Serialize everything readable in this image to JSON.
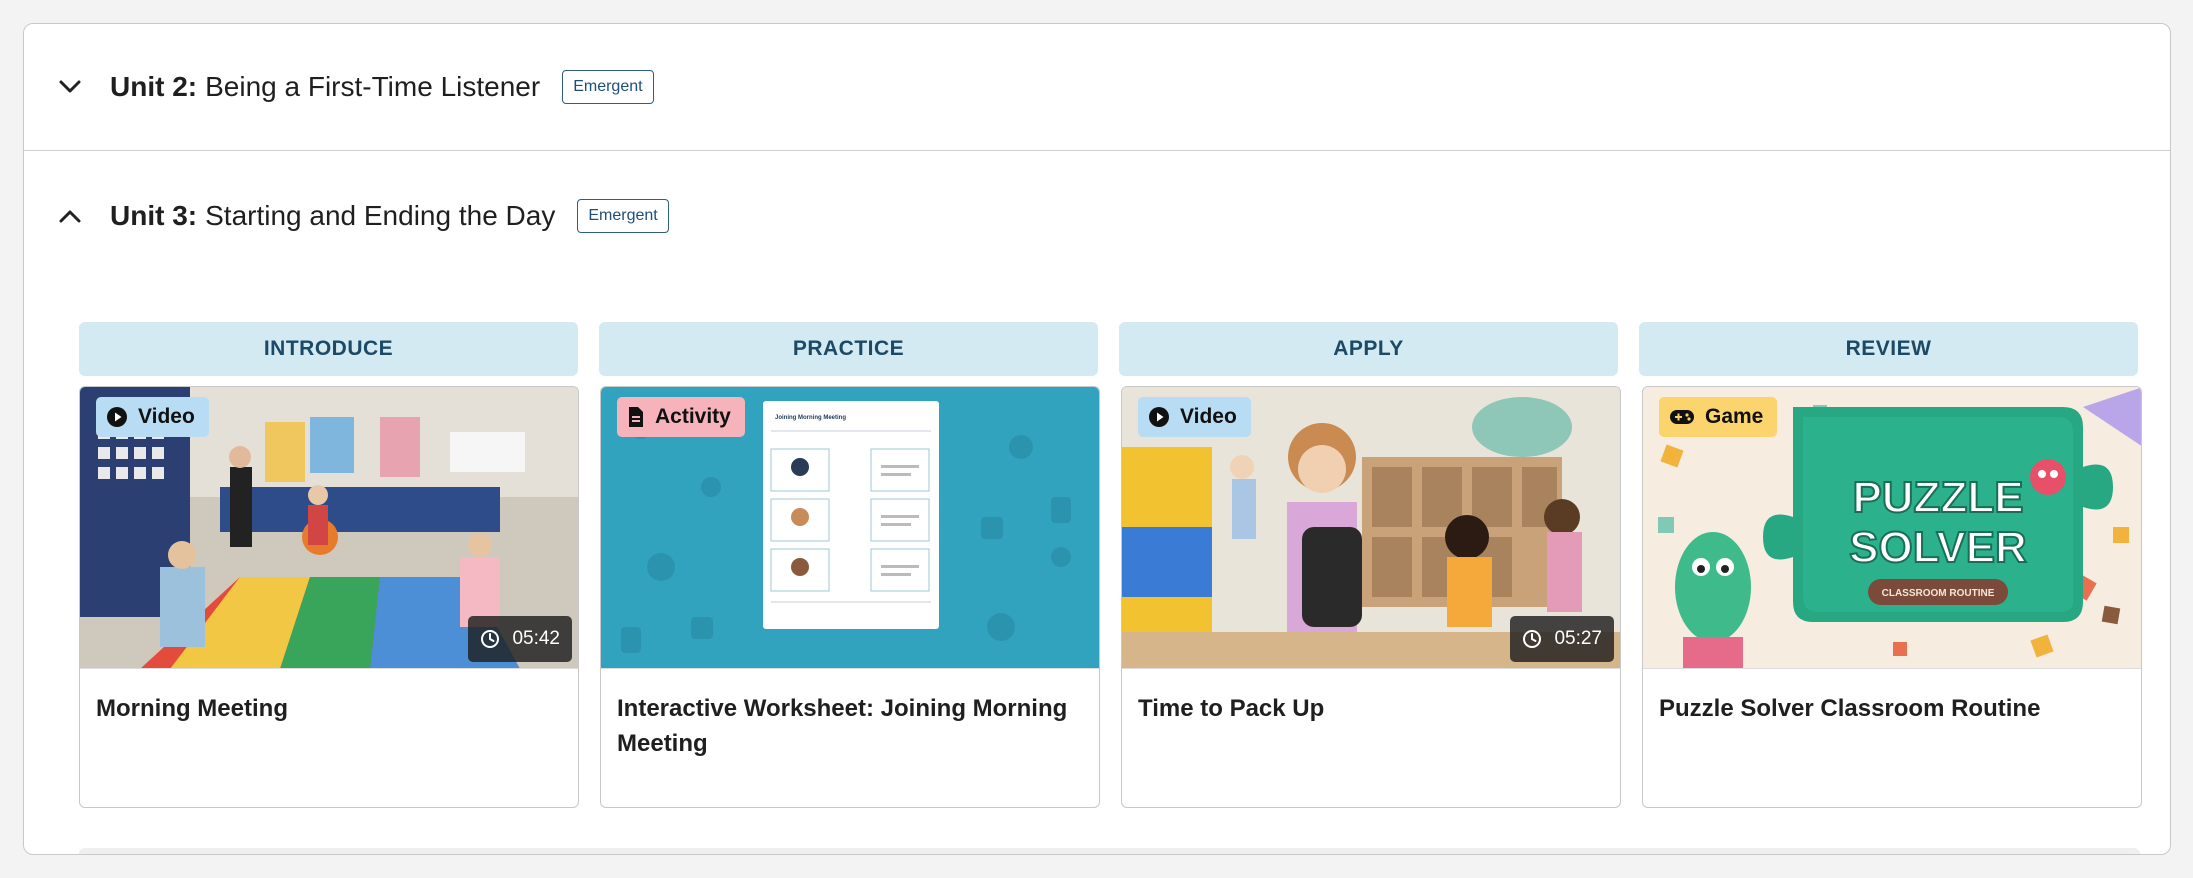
{
  "units": [
    {
      "number": "Unit 2:",
      "title": "Being a First-Time Listener",
      "level": "Emergent",
      "expanded": false
    },
    {
      "number": "Unit 3:",
      "title": "Starting and Ending the Day",
      "level": "Emergent",
      "expanded": true
    }
  ],
  "stages": [
    "INTRODUCE",
    "PRACTICE",
    "APPLY",
    "REVIEW"
  ],
  "cards": [
    {
      "type": "Video",
      "icon": "play-icon",
      "duration": "05:42",
      "title": "Morning Meeting"
    },
    {
      "type": "Activity",
      "icon": "document-icon",
      "duration": "",
      "title": "Interactive Worksheet: Joining Morning Meeting"
    },
    {
      "type": "Video",
      "icon": "play-icon",
      "duration": "05:27",
      "title": "Time to Pack Up"
    },
    {
      "type": "Game",
      "icon": "gamepad-icon",
      "duration": "",
      "title": "Puzzle Solver Classroom Routine"
    }
  ],
  "thumbnail_text": {
    "worksheet_header": "Joining Morning Meeting",
    "game_line1": "PUZZLE",
    "game_line2": "SOLVER",
    "game_subtitle": "CLASSROOM ROUTINE"
  },
  "colors": {
    "stage_bg": "#d3eaf2",
    "badge_border": "#2f5d86",
    "video_tag": "#b9dcf5",
    "activity_tag": "#f6b3bb",
    "game_tag": "#fbd46e"
  }
}
